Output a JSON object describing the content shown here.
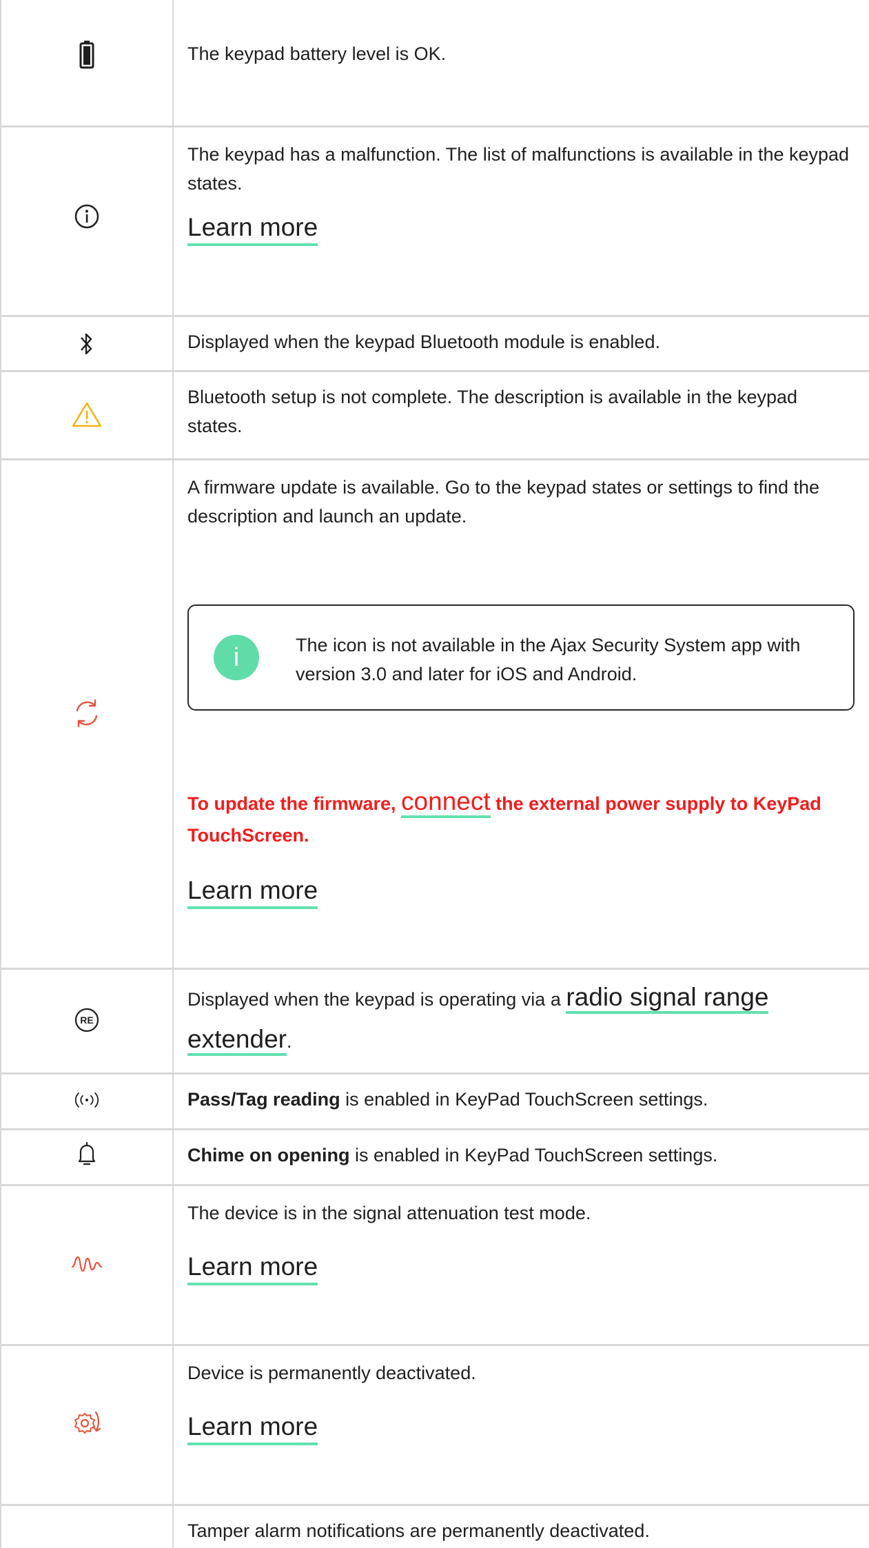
{
  "colors": {
    "accent_underline": "#62e0b0",
    "warning_red": "#f21d1d",
    "warning_yellow": "#f2b40c",
    "icon_red": "#e8513a",
    "note_badge": "#5fdca8"
  },
  "rows": [
    {
      "icon": "battery-full-icon",
      "text": "The keypad battery level is OK."
    },
    {
      "icon": "info-circle-icon",
      "text": "The keypad has a malfunction. The list of malfunctions is available in the keypad states.",
      "link": "Learn more"
    },
    {
      "icon": "bluetooth-icon",
      "text": "Displayed when the keypad Bluetooth module is enabled."
    },
    {
      "icon": "warning-triangle-icon",
      "text": "Bluetooth setup is not complete. The description is available in the keypad states."
    },
    {
      "icon": "firmware-update-icon",
      "text": "A firmware update is available. Go to the keypad states or settings to find the description and launch an update.",
      "note": {
        "badge": "i",
        "text": "The icon is not available in the Ajax Security System app with version 3.0 and later for iOS and Android."
      },
      "warning": {
        "before": "To update the firmware, ",
        "link": "connect",
        "after": " the external power supply to KeyPad TouchScreen."
      },
      "link": "Learn more"
    },
    {
      "icon": "range-extender-icon",
      "icon_label": "RE",
      "text_before": "Displayed when the keypad is operating via a ",
      "link": "radio signal range extender",
      "text_after": "."
    },
    {
      "icon": "pass-tag-reading-icon",
      "bold": "Pass/Tag reading",
      "text": " is enabled in KeyPad TouchScreen settings."
    },
    {
      "icon": "chime-bell-icon",
      "bold": "Chime on opening",
      "text": " is enabled in KeyPad TouchScreen settings."
    },
    {
      "icon": "signal-attenuation-icon",
      "text": "The device is in the signal attenuation test mode.",
      "link": "Learn more"
    },
    {
      "icon": "device-deactivated-icon",
      "text": "Device is permanently deactivated.",
      "link": "Learn more"
    },
    {
      "text": "Tamper alarm notifications are permanently deactivated."
    }
  ]
}
